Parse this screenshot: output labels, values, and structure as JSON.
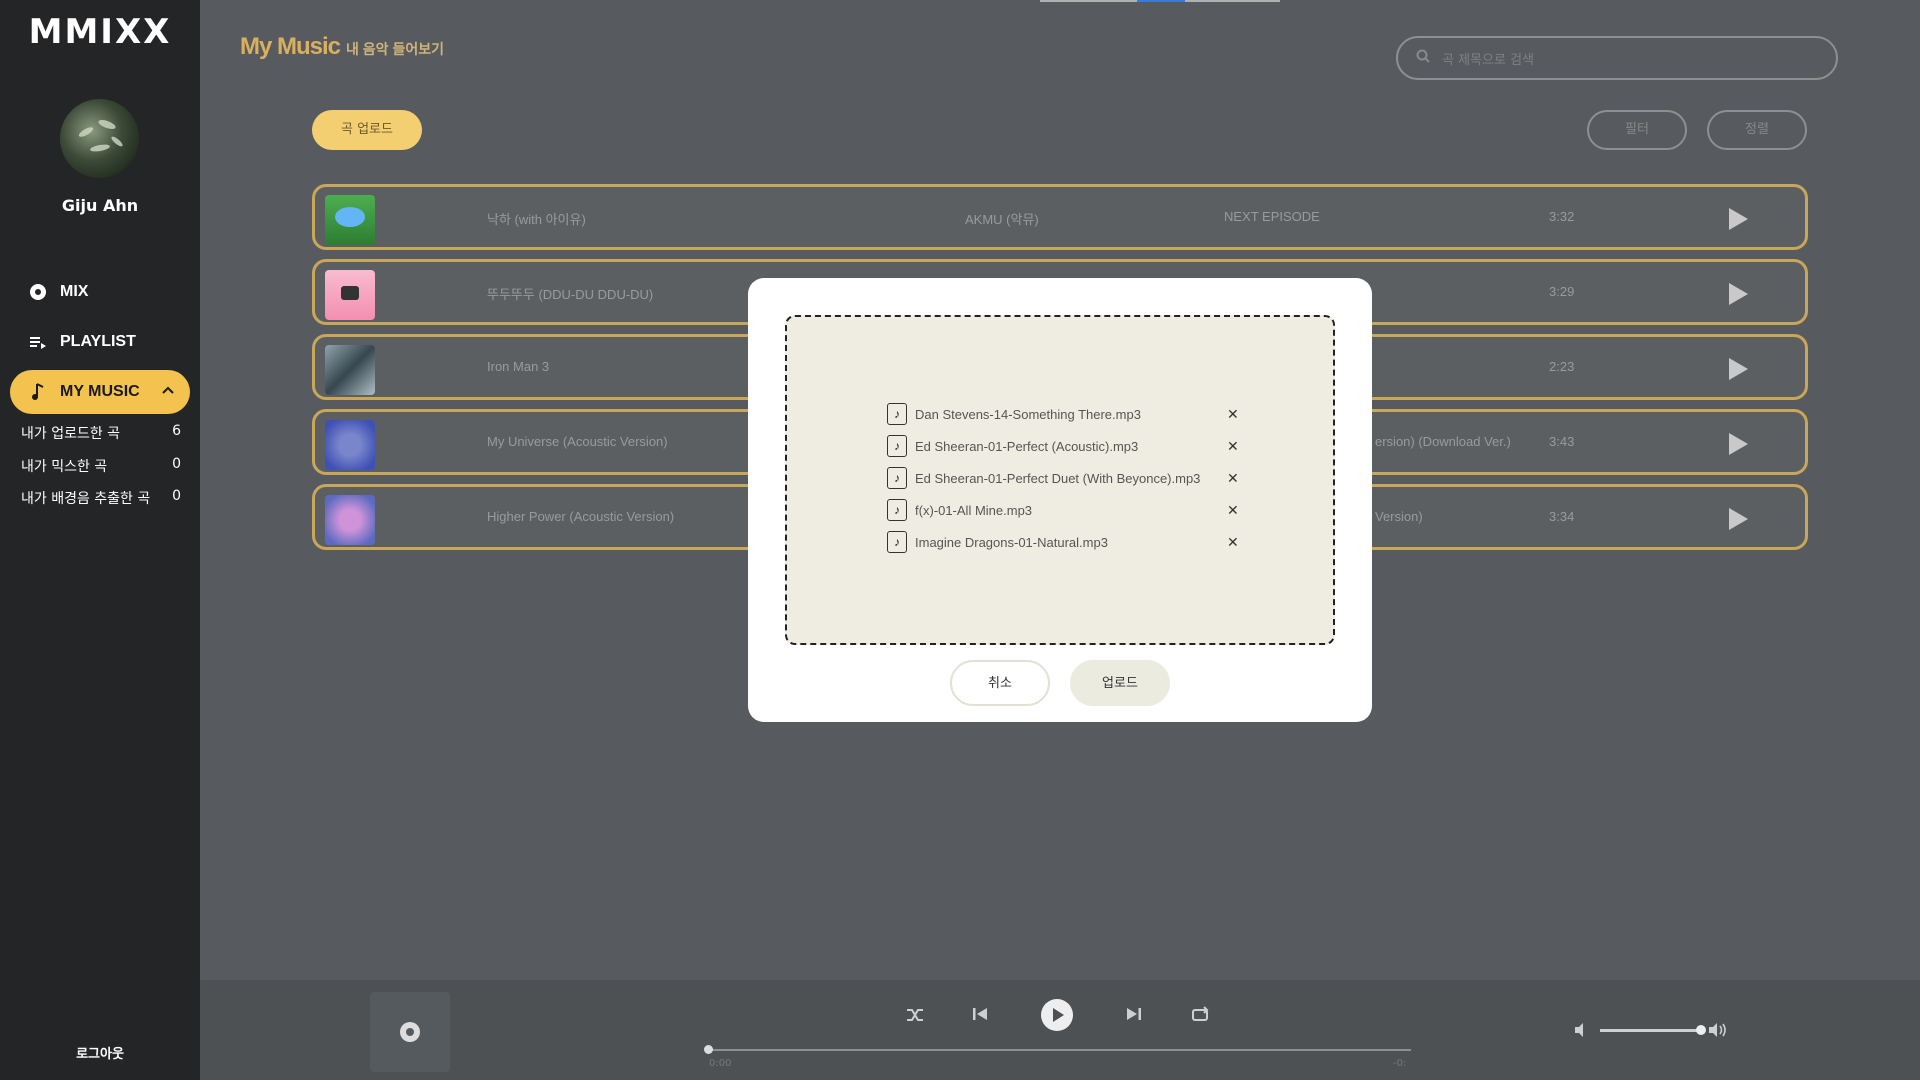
{
  "app": {
    "logo": "MMIXX",
    "username": "Giju Ahn"
  },
  "nav": [
    {
      "label": "MIX",
      "icon": "disc-icon"
    },
    {
      "label": "PLAYLIST",
      "icon": "playlist-icon"
    },
    {
      "label": "MY MUSIC",
      "icon": "music-note-icon",
      "active": true
    }
  ],
  "submenu": [
    {
      "label": "내가 업로드한 곡",
      "count": "6"
    },
    {
      "label": "내가 믹스한 곡",
      "count": "0"
    },
    {
      "label": "내가 배경음 추출한 곡",
      "count": "0"
    }
  ],
  "logout": "로그아웃",
  "header": {
    "title": "My Music",
    "subtitle": "내 음악 들어보기",
    "search_placeholder": "곡 제목으로 검색"
  },
  "toolbar": {
    "upload": "곡 업로드",
    "filter": "필터",
    "sort": "정렬"
  },
  "songs": [
    {
      "title": "낙하 (with 아이유)",
      "artist": "AKMU (악뮤)",
      "album": "NEXT EPISODE",
      "duration": "3:32"
    },
    {
      "title": "뚜두뚜두 (DDU-DU DDU-DU)",
      "artist": "",
      "album": "",
      "duration": "3:29"
    },
    {
      "title": "Iron Man 3",
      "artist": "",
      "album": "",
      "duration": "2:23"
    },
    {
      "title": "My Universe (Acoustic Version)",
      "artist": "",
      "album": "ersion) (Download Ver.)",
      "duration": "3:43"
    },
    {
      "title": "Higher Power (Acoustic Version)",
      "artist": "",
      "album": "Version)",
      "duration": "3:34"
    }
  ],
  "modal": {
    "files": [
      "Dan Stevens-14-Something There.mp3",
      "Ed Sheeran-01-Perfect (Acoustic).mp3",
      "Ed Sheeran-01-Perfect Duet (With Beyonce).mp3",
      "f(x)-01-All Mine.mp3",
      "Imagine Dragons-01-Natural.mp3"
    ],
    "cancel": "취소",
    "upload": "업로드"
  },
  "player": {
    "time_current": "0:00",
    "time_total": "-0:",
    "volume": 0.98
  }
}
